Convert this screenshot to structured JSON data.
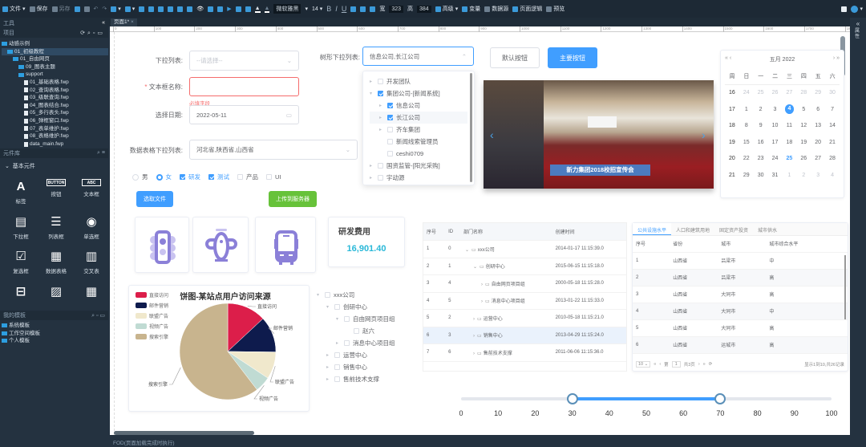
{
  "toolbar": {
    "file": "文件",
    "save": "保存",
    "save_as": "另存",
    "font": "微软雅黑",
    "font_size": "14",
    "bold": "B",
    "italic": "I",
    "underline": "U",
    "width": "323",
    "height": "384",
    "advanced": "高级",
    "variables": "变量",
    "datasource": "数据源",
    "page_logic": "页面逻辑",
    "preview": "预览"
  },
  "left": {
    "tools_title": "工具",
    "project_title": "项目",
    "tree": [
      {
        "label": "动感示例",
        "type": "root",
        "level": 0
      },
      {
        "label": "01_初级教程",
        "type": "folder",
        "level": 1,
        "selected": true
      },
      {
        "label": "01_自由网页",
        "type": "folder",
        "level": 2
      },
      {
        "label": "09_图表主题",
        "type": "folder",
        "level": 3
      },
      {
        "label": "support",
        "type": "folder",
        "level": 3
      },
      {
        "label": "01_基础表格.fwp",
        "type": "file",
        "level": 4
      },
      {
        "label": "02_查询表格.fwp",
        "type": "file",
        "level": 4
      },
      {
        "label": "03_级联查询.fwp",
        "type": "file",
        "level": 4
      },
      {
        "label": "04_图表结合.fwp",
        "type": "file",
        "level": 4
      },
      {
        "label": "05_多行表头.fwp",
        "type": "file",
        "level": 4
      },
      {
        "label": "06_弹框窗口.fwp",
        "type": "file",
        "level": 4
      },
      {
        "label": "07_表单维护.fwp",
        "type": "file",
        "level": 4
      },
      {
        "label": "08_表格维护.fwp",
        "type": "file",
        "level": 4
      },
      {
        "label": "data_main.fwp",
        "type": "file",
        "level": 4
      }
    ],
    "components_title": "元件库",
    "basic_group": "基本元件",
    "components": [
      {
        "label": "标签",
        "icon": "A"
      },
      {
        "label": "按钮",
        "icon": "BUTTON"
      },
      {
        "label": "文本框",
        "icon": "ABC"
      },
      {
        "label": "下拉框",
        "icon": "▤"
      },
      {
        "label": "列表框",
        "icon": "☰"
      },
      {
        "label": "单选框",
        "icon": "◉"
      },
      {
        "label": "复选框",
        "icon": "☑"
      },
      {
        "label": "数据表格",
        "icon": "▦"
      },
      {
        "label": "交叉表",
        "icon": "▥"
      },
      {
        "label": "",
        "icon": "⊟"
      },
      {
        "label": "",
        "icon": "▨"
      },
      {
        "label": "",
        "icon": "▦"
      }
    ],
    "templates_title": "我的模板",
    "templates": [
      "系统模板",
      "工作空间模板",
      "个人模板"
    ]
  },
  "tab": {
    "label": "页面1*"
  },
  "ruler": [
    "0",
    "100",
    "200",
    "300",
    "400",
    "500",
    "600",
    "700",
    "800",
    "900",
    "1000",
    "1100",
    "1200",
    "1300",
    "1400",
    "1500",
    "1600",
    "1700",
    "1800"
  ],
  "form": {
    "select_label": "下拉列表:",
    "select_placeholder": "--请选择--",
    "text_label": "文本框名称:",
    "required_mark": "*",
    "required_msg": "必填字段",
    "date_label": "选择日期:",
    "date_value": "2022-05-11",
    "grid_select_label": "数据表格下拉列表:",
    "grid_select_value": "河北省,陕西省,山西省",
    "tree_select_label": "树形下拉列表:",
    "tree_select_value": "信息公司,长江公司"
  },
  "tree_dropdown": [
    {
      "label": "开发团队",
      "level": 0,
      "expand": "right",
      "checked": false
    },
    {
      "label": "集团公司-[新闻系统]",
      "level": 0,
      "expand": "down",
      "checked": true
    },
    {
      "label": "信息公司",
      "level": 1,
      "expand": "right",
      "checked": true
    },
    {
      "label": "长江公司",
      "level": 1,
      "expand": "right",
      "checked": true,
      "hover": true
    },
    {
      "label": "齐车集团",
      "level": 1,
      "expand": "right",
      "checked": false
    },
    {
      "label": "新闻线索管理员",
      "level": 1,
      "expand": "",
      "checked": false
    },
    {
      "label": "ceshi0709",
      "level": 1,
      "expand": "",
      "checked": false
    },
    {
      "label": "国资监管-[阳光采购]",
      "level": 0,
      "expand": "right",
      "checked": false
    },
    {
      "label": "宇动源",
      "level": 0,
      "expand": "right",
      "checked": false
    }
  ],
  "options": {
    "radios": [
      {
        "label": "男",
        "checked": false
      },
      {
        "label": "女",
        "checked": true
      }
    ],
    "checkboxes": [
      {
        "label": "研发",
        "checked": true
      },
      {
        "label": "测试",
        "checked": true
      },
      {
        "label": "产品",
        "checked": false
      },
      {
        "label": "UI",
        "checked": false
      }
    ]
  },
  "buttons": {
    "choose_file": "选取文件",
    "upload": "上传到服务器",
    "default": "默认按钮",
    "primary": "主要按钮",
    "primary_color": "#409eff",
    "upload_color": "#67c23a"
  },
  "carousel": {
    "caption": "新力集团2018校招宣传会"
  },
  "calendar": {
    "month": "五月 2022",
    "weekday_header": [
      "周",
      "日",
      "一",
      "二",
      "三",
      "四",
      "五",
      "六"
    ],
    "weeks": [
      {
        "wk": "16",
        "days": [
          "24",
          "25",
          "26",
          "27",
          "28",
          "29",
          "30"
        ]
      },
      {
        "wk": "17",
        "days": [
          "1",
          "2",
          "3",
          "4",
          "5",
          "6",
          "7"
        ]
      },
      {
        "wk": "18",
        "days": [
          "8",
          "9",
          "10",
          "11",
          "12",
          "13",
          "14"
        ]
      },
      {
        "wk": "19",
        "days": [
          "15",
          "16",
          "17",
          "18",
          "19",
          "20",
          "21"
        ]
      },
      {
        "wk": "20",
        "days": [
          "22",
          "23",
          "24",
          "25",
          "26",
          "27",
          "28"
        ]
      },
      {
        "wk": "21",
        "days": [
          "29",
          "30",
          "31",
          "1",
          "2",
          "3",
          "4"
        ]
      }
    ],
    "selected": "4",
    "today": "25"
  },
  "stat": {
    "title": "研发费用",
    "value": "16,901.40"
  },
  "pie": {
    "title": "饼图-某站点用户访问来源",
    "subtitle": "纯属虚构"
  },
  "chart_data": {
    "type": "pie",
    "title": "饼图-某站点用户访问来源",
    "subtitle": "纯属虚构",
    "legend_placement": "top-left",
    "slices": [
      {
        "name": "直接访问",
        "value": 335,
        "color": "#dc1e4a"
      },
      {
        "name": "邮件营销",
        "value": 310,
        "color": "#0e1b4d"
      },
      {
        "name": "联盟广告",
        "value": 234,
        "color": "#f0e8cc"
      },
      {
        "name": "视频广告",
        "value": 135,
        "color": "#c0dbd3"
      },
      {
        "name": "搜索引擎",
        "value": 1548,
        "color": "#c8b48e"
      }
    ]
  },
  "org_tree": [
    {
      "label": "xxx公司",
      "level": 0,
      "expand": "down"
    },
    {
      "label": "创研中心",
      "level": 1,
      "expand": "down"
    },
    {
      "label": "自由网页项目组",
      "level": 2,
      "expand": "down"
    },
    {
      "label": "赵六",
      "level": 3,
      "expand": ""
    },
    {
      "label": "消息中心项目组",
      "level": 2,
      "expand": "right"
    },
    {
      "label": "运营中心",
      "level": 1,
      "expand": "right"
    },
    {
      "label": "销售中心",
      "level": 1,
      "expand": "right"
    },
    {
      "label": "售前技术支撑",
      "level": 1,
      "expand": "right"
    }
  ],
  "tree_table": {
    "headers": [
      "序号",
      "ID",
      "部门名称",
      "创建时间"
    ],
    "rows": [
      {
        "no": "1",
        "id": "0",
        "name": "xxx公司",
        "level": 0,
        "expand": "down",
        "time": "2014-01-17 11:15:39.0"
      },
      {
        "no": "2",
        "id": "1",
        "name": "创研中心",
        "level": 1,
        "expand": "down",
        "time": "2015-06-15 11:15:18.0"
      },
      {
        "no": "3",
        "id": "4",
        "name": "自由网页项目组",
        "level": 2,
        "expand": "right",
        "time": "2000-05-18 11:15:28.0"
      },
      {
        "no": "4",
        "id": "5",
        "name": "消息中心项目组",
        "level": 2,
        "expand": "right",
        "time": "2013-01-22 11:15:33.0"
      },
      {
        "no": "5",
        "id": "2",
        "name": "运营中心",
        "level": 1,
        "expand": "right",
        "time": "2010-05-18 11:15:21.0"
      },
      {
        "no": "6",
        "id": "3",
        "name": "销售中心",
        "level": 1,
        "expand": "right",
        "time": "2013-04-29 11:15:24.0",
        "hover": true
      },
      {
        "no": "7",
        "id": "6",
        "name": "售前技术支撑",
        "level": 1,
        "expand": "right",
        "time": "2011-06-06 11:15:36.0"
      }
    ]
  },
  "tab_table": {
    "tabs": [
      "公共设施水平",
      "人口和建筑用地",
      "固定资产投资",
      "城市供水"
    ],
    "headers": [
      "序号",
      "省份",
      "城市",
      "城市综合水平"
    ],
    "rows": [
      [
        "1",
        "山西省",
        "吕梁市",
        "中"
      ],
      [
        "2",
        "山西省",
        "吕梁市",
        "高"
      ],
      [
        "3",
        "山西省",
        "大同市",
        "高"
      ],
      [
        "4",
        "山西省",
        "大同市",
        "中"
      ],
      [
        "5",
        "山西省",
        "大同市",
        "高"
      ],
      [
        "6",
        "山西省",
        "运城市",
        "高"
      ]
    ],
    "pager": {
      "page_size": "10",
      "page_prefix": "第",
      "page": "1",
      "page_suffix": "共3页",
      "summary": "显示1到10,共26记录"
    }
  },
  "slider": {
    "min": 0,
    "max": 100,
    "low": 30,
    "high": 70,
    "ticks": [
      "0",
      "10",
      "20",
      "30",
      "40",
      "50",
      "60",
      "70",
      "80",
      "90",
      "100"
    ]
  },
  "status": {
    "text": "FOD(页面加载完成时执行)"
  }
}
